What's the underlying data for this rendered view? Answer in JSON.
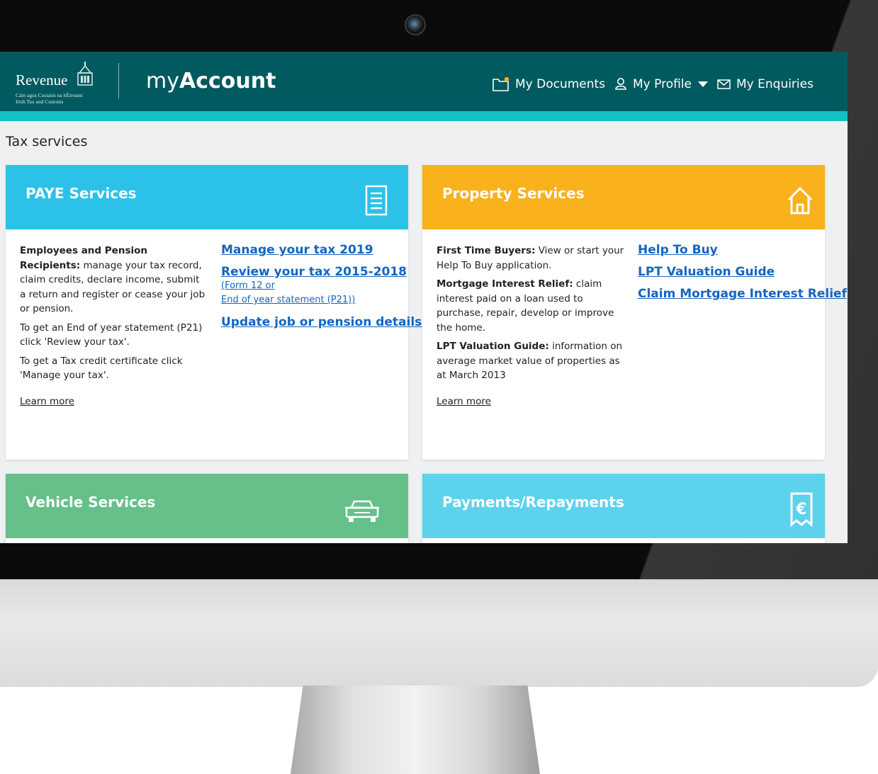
{
  "header": {
    "logo_word": "Revenue",
    "logo_sub_1": "Cáin agus Custaim na hÉireann",
    "logo_sub_2": "Irish Tax and Customs",
    "app_title_prefix": "my",
    "app_title_bold": "Account",
    "nav": {
      "documents": "My Documents",
      "profile": "My Profile",
      "enquiries": "My Enquiries"
    }
  },
  "page_title": "Tax services",
  "cards": {
    "paye": {
      "title": "PAYE Services",
      "desc_bold": "Employees and Pension Recipients:",
      "desc_1": "manage your tax record, claim credits, declare income, submit a return and register or cease your job or pension.",
      "desc_2": "To get an End of year statement (P21) click 'Review your tax'.",
      "desc_3": "To get a Tax credit certificate click 'Manage your tax'.",
      "learn_more": "Learn more",
      "link_1": "Manage your tax 2019",
      "link_2": "Review your tax 2015-2018",
      "link_2_sub_1": "(Form 12 or",
      "link_2_sub_2": "End of year statement (P21))",
      "link_3": "Update job or pension details"
    },
    "property": {
      "title": "Property Services",
      "p1_bold": "First Time Buyers:",
      "p1": "View or start your Help To Buy application.",
      "p2_bold": "Mortgage Interest Relief:",
      "p2": "claim interest paid on a loan used to purchase, repair, develop or improve the home.",
      "p3_bold": "LPT Valuation Guide:",
      "p3": "information on average market value of properties as at March 2013",
      "learn_more": "Learn more",
      "link_1": "Help To Buy",
      "link_2": "LPT Valuation Guide",
      "link_3": "Claim Mortgage Interest Relief"
    },
    "vehicle": {
      "title": "Vehicle Services"
    },
    "payments": {
      "title": "Payments/Repayments"
    }
  },
  "colors": {
    "topbar": "#005a5f",
    "accent": "#12c1c6",
    "paye": "#2bc1e9",
    "property": "#f9b11c",
    "vehicle": "#66c089",
    "payments": "#5dd2ec",
    "link": "#1565c0"
  },
  "icons": {
    "documents": "folder-icon",
    "profile": "user-icon",
    "profile_caret": "caret-down-icon",
    "enquiries": "envelope-icon",
    "paye": "document-icon",
    "property": "house-icon",
    "vehicle": "car-icon",
    "payments": "euro-receipt-icon"
  }
}
